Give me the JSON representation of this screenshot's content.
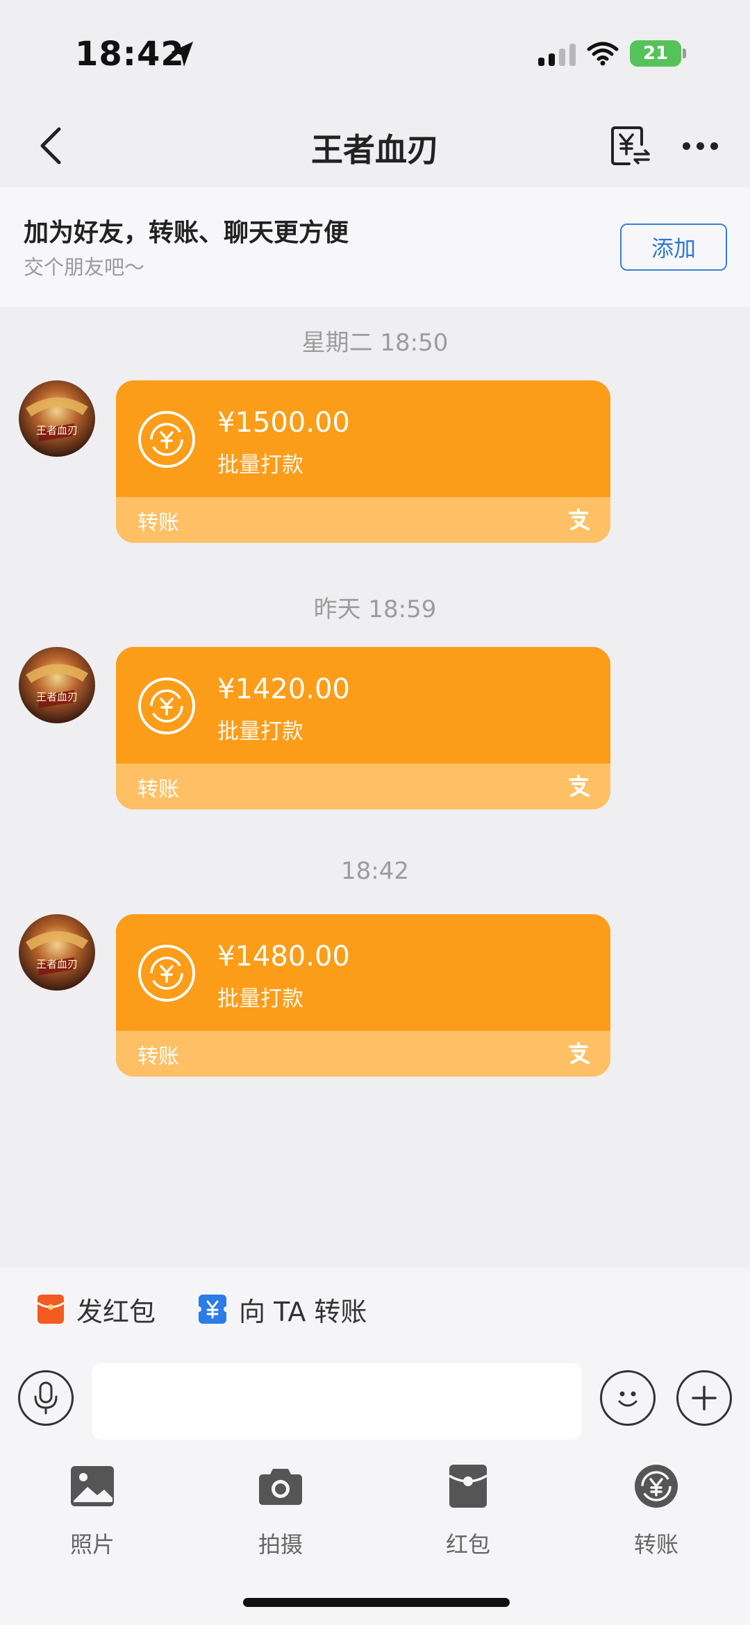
{
  "status_bar": {
    "time": "18:42",
    "battery": "21"
  },
  "nav": {
    "title": "王者血刃"
  },
  "banner": {
    "title": "加为好友，转账、聊天更方便",
    "subtitle": "交个朋友吧～",
    "add_label": "添加"
  },
  "messages": [
    {
      "time": "星期二 18:50",
      "amount": "¥1500.00",
      "desc": "批量打款",
      "type": "转账",
      "avatar_text": "王者血刃"
    },
    {
      "time": "昨天 18:59",
      "amount": "¥1420.00",
      "desc": "批量打款",
      "type": "转账",
      "avatar_text": "王者血刃"
    },
    {
      "time": "18:42",
      "amount": "¥1480.00",
      "desc": "批量打款",
      "type": "转账",
      "avatar_text": "王者血刃"
    }
  ],
  "quick_actions": [
    {
      "label": "发红包",
      "icon": "red-packet-icon",
      "color": "#f25a1f"
    },
    {
      "label": "向 TA 转账",
      "icon": "transfer-icon",
      "color": "#2b7ce8"
    }
  ],
  "input": {
    "value": "",
    "placeholder": ""
  },
  "tools": [
    {
      "label": "照片",
      "icon": "photo-icon"
    },
    {
      "label": "拍摄",
      "icon": "camera-icon"
    },
    {
      "label": "红包",
      "icon": "red-packet-icon"
    },
    {
      "label": "转账",
      "icon": "transfer-icon"
    }
  ],
  "colors": {
    "card_orange": "#fb9d19",
    "card_footer": "#ffbf64",
    "link_blue": "#2f78d2",
    "background": "#efeff1"
  }
}
